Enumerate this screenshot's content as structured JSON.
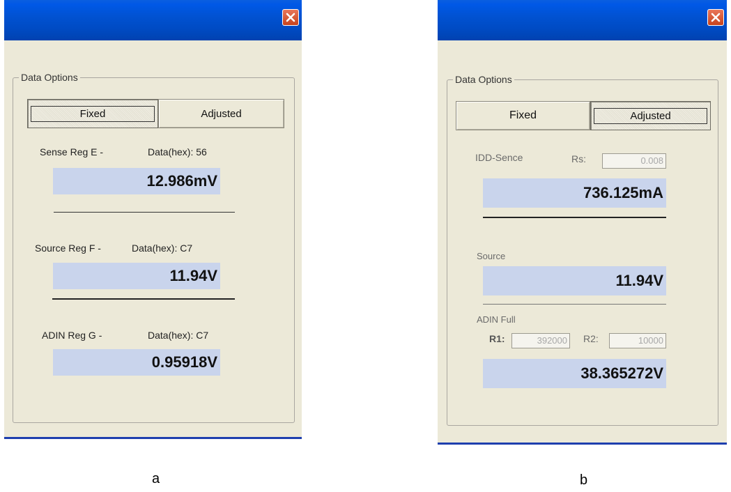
{
  "panel_a": {
    "group_label": "Data Options",
    "fixed_label": "Fixed",
    "adjusted_label": "Adjusted",
    "sense": {
      "name": "Sense Reg E -",
      "hex": "Data(hex): 56",
      "value": "12.986mV"
    },
    "source": {
      "name": "Source Reg F -",
      "hex": "Data(hex): C7",
      "value": "11.94V"
    },
    "adin": {
      "name": "ADIN Reg G -",
      "hex": "Data(hex): C7",
      "value": "0.95918V"
    },
    "caption": "a"
  },
  "panel_b": {
    "group_label": "Data Options",
    "fixed_label": "Fixed",
    "adjusted_label": "Adjusted",
    "idd": {
      "name": "IDD-Sence",
      "rs_label": "Rs:",
      "rs_value": "0.008",
      "value": "736.125mA"
    },
    "source": {
      "name": "Source",
      "value": "11.94V"
    },
    "adin": {
      "name": "ADIN Full",
      "r1_label": "R1:",
      "r1_value": "392000",
      "r2_label": "R2:",
      "r2_value": "10000",
      "value": "38.365272V"
    },
    "caption": "b"
  },
  "colors": {
    "titlebar": "#0054E3",
    "dialog_bg": "#ECE9D8",
    "readout_bg": "#C9D4EC",
    "close": "#D2522C"
  }
}
